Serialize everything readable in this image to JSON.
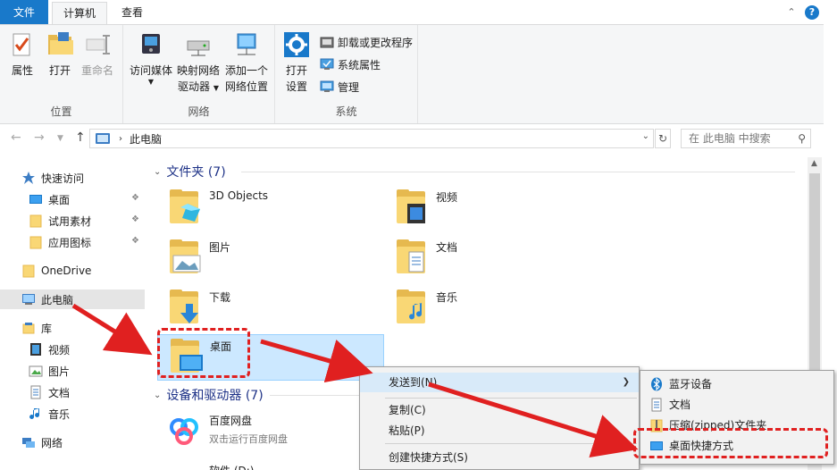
{
  "ribbon_tabs": {
    "file": "文件",
    "computer": "计算机",
    "view": "查看"
  },
  "ribbon": {
    "location": {
      "label": "位置",
      "properties": "属性",
      "open": "打开",
      "rename": "重命名"
    },
    "network": {
      "label": "网络",
      "access_media": "访问媒体",
      "map_drive_1": "映射网络",
      "map_drive_2": "驱动器",
      "add_location_1": "添加一个",
      "add_location_2": "网络位置"
    },
    "system": {
      "label": "系统",
      "open_settings_1": "打开",
      "open_settings_2": "设置",
      "uninstall": "卸载或更改程序",
      "sys_props": "系统属性",
      "manage": "管理"
    }
  },
  "address": {
    "path": "此电脑",
    "search_placeholder": "在 此电脑 中搜索"
  },
  "sidebar": {
    "quick_access": "快速访问",
    "desktop": "桌面",
    "test_material": "试用素材",
    "app_icons": "应用图标",
    "onedrive": "OneDrive",
    "this_pc": "此电脑",
    "libraries": "库",
    "lib_video": "视频",
    "lib_pictures": "图片",
    "lib_docs": "文档",
    "lib_music": "音乐",
    "network": "网络"
  },
  "content": {
    "folders_header": "文件夹 (7)",
    "folders": {
      "objects3d": "3D Objects",
      "video": "视频",
      "pictures": "图片",
      "docs": "文档",
      "downloads": "下载",
      "music": "音乐",
      "desktop": "桌面"
    },
    "devices_header": "设备和驱动器 (7)",
    "baidu_name": "百度网盘",
    "baidu_sub": "双击运行百度网盘",
    "partial_drive": "软件 (D:)"
  },
  "context_menu": {
    "send_to": "发送到(N)",
    "copy": "复制(C)",
    "paste": "粘贴(P)",
    "create_shortcut": "创建快捷方式(S)"
  },
  "sendto_menu": {
    "bluetooth": "蓝牙设备",
    "docs": "文档",
    "zip": "压缩(zipped)文件夹",
    "desktop_shortcut": "桌面快捷方式"
  },
  "colors": {
    "accent": "#1979ca",
    "annotation_red": "#e02020",
    "selection": "#cce8ff"
  }
}
